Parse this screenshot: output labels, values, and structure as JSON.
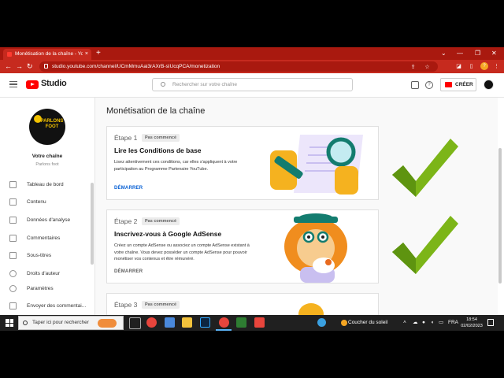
{
  "browser": {
    "tab_title": "Monétisation de la chaîne - YouTube",
    "tab_close": "×",
    "new_tab": "+",
    "url": "studio.youtube.com/channel/UCmMmuAai3rAXrB-sIUcqPCA/monetization",
    "window_controls": [
      "⌄",
      "—",
      "❐",
      "✕"
    ],
    "profile_initial": "?"
  },
  "header": {
    "logo_text": "Studio",
    "search_placeholder": "Rechercher sur votre chaîne",
    "help_icon": "?",
    "create_label": "CRÉER"
  },
  "sidebar": {
    "avatar_text": "PARLONS FOOT",
    "your_channel": "Votre chaîne",
    "channel_name": "Parlons foot",
    "items": [
      {
        "label": "Tableau de bord",
        "icon": "dashboard-icon"
      },
      {
        "label": "Contenu",
        "icon": "content-icon"
      },
      {
        "label": "Données d'analyse",
        "icon": "analytics-icon"
      },
      {
        "label": "Commentaires",
        "icon": "comments-icon"
      },
      {
        "label": "Sous-titres",
        "icon": "subtitles-icon"
      },
      {
        "label": "Droits d'auteur",
        "icon": "copyright-icon"
      },
      {
        "label": "Paramètres",
        "icon": "settings-icon"
      },
      {
        "label": "Envoyer des commentai...",
        "icon": "feedback-icon"
      }
    ]
  },
  "main": {
    "title": "Monétisation de la chaîne",
    "cards": [
      {
        "step": "Étape 1",
        "badge": "Pas commencé",
        "title": "Lire les Conditions de base",
        "desc": "Lisez attentivement ces conditions, car elles s'appliquent à votre participation au Programme Partenaire YouTube.",
        "action": "DÉMARRER"
      },
      {
        "step": "Étape 2",
        "badge": "Pas commencé",
        "title": "Inscrivez-vous à Google AdSense",
        "desc": "Créez un compte AdSense ou associez un compte AdSense existant à votre chaîne. Vous devez posséder un compte AdSense pour pouvoir monétiser vos contenus et être rémunéré.",
        "action": "DÉMARRER"
      },
      {
        "step": "Étape 3",
        "badge": "Pas commencé",
        "title": "",
        "desc": "",
        "action": ""
      }
    ]
  },
  "overlay": {
    "check_color": "#7cb518"
  },
  "taskbar": {
    "search_placeholder": "Taper ici pour rechercher",
    "weather": "Coucher du soleil",
    "lang": "FRA",
    "time": "18:54",
    "date": "02/02/2023"
  }
}
